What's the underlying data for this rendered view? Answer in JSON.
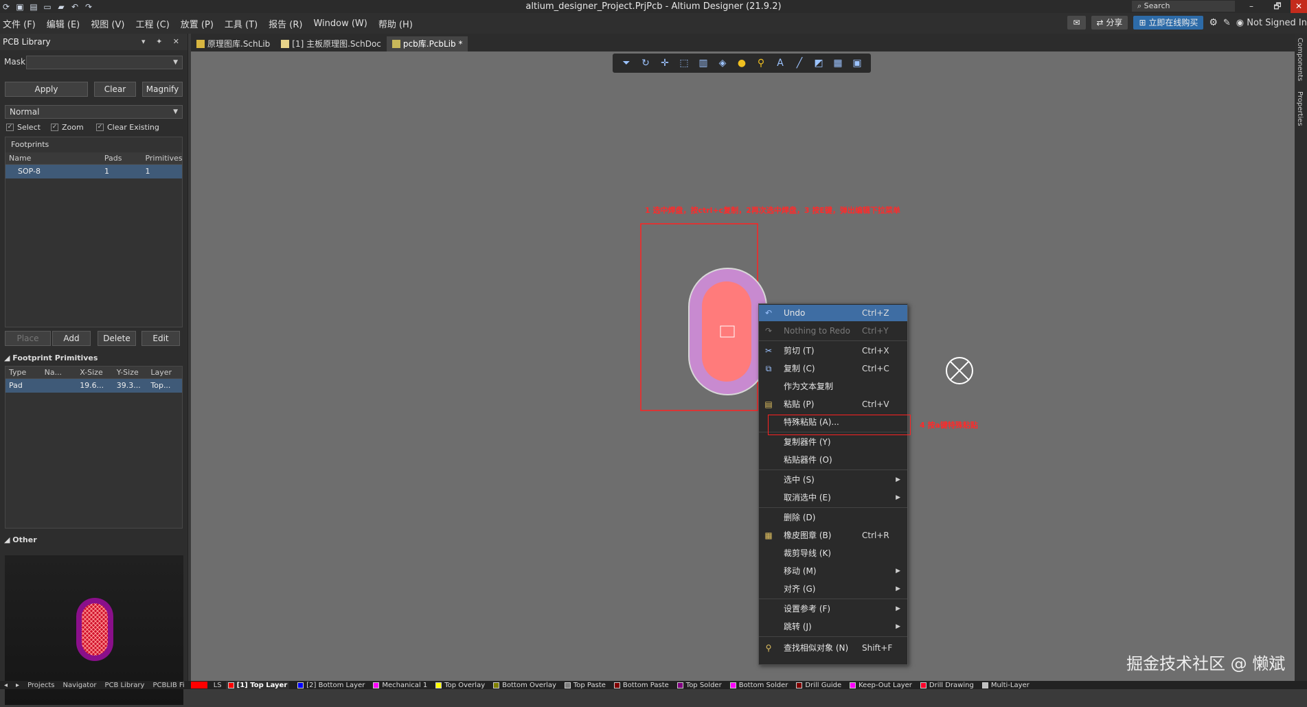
{
  "titlebar": {
    "title": "altium_designer_Project.PrjPcb - Altium Designer (21.9.2)",
    "search_placeholder": "Search",
    "minimize": "–",
    "maximize": "🗗",
    "close": "✕"
  },
  "menu": {
    "items": [
      "文件 (F)",
      "编辑 (E)",
      "视图 (V)",
      "工程 (C)",
      "放置 (P)",
      "工具 (T)",
      "报告 (R)",
      "Window (W)",
      "帮助 (H)"
    ],
    "share": "分享",
    "buy": "立即在线购买",
    "user": "Not Signed In"
  },
  "panel": {
    "title": "PCB Library",
    "mask_label": "Mask",
    "mask_value": "",
    "apply": "Apply",
    "clear": "Clear",
    "magnify": "Magnify",
    "mode": "Normal",
    "chk_select": "Select",
    "chk_zoom": "Zoom",
    "chk_clear_existing": "Clear Existing",
    "footprints_title": "Footprints",
    "footprint_headers": [
      "Name",
      "Pads",
      "Primitives"
    ],
    "footprint_rows": [
      [
        "SOP-8",
        "1",
        "1"
      ]
    ],
    "place": "Place",
    "add": "Add",
    "delete": "Delete",
    "edit": "Edit",
    "primitives_title": "Footprint Primitives",
    "primitive_headers": [
      "Type",
      "Na...",
      "X-Size",
      "Y-Size",
      "Layer"
    ],
    "primitive_rows": [
      [
        "Pad",
        "",
        "19.6...",
        "39.3...",
        "Top..."
      ]
    ],
    "other_title": "Other"
  },
  "tabs": [
    {
      "label": "原理图库.SchLib"
    },
    {
      "label": "[1] 主板原理图.SchDoc"
    },
    {
      "label": "pcb库.PcbLib *"
    }
  ],
  "rightbar": {
    "components": "Components",
    "properties": "Properties"
  },
  "annotations": {
    "step1": "1 选中焊盘，按ctrl+c复制，2再次选中焊盘，3 按E键，弹出编辑下拉菜单",
    "step4": "4 按a键特殊粘贴"
  },
  "context_menu": [
    {
      "label": "Undo",
      "shortcut": "Ctrl+Z",
      "icon": "undo-icon",
      "state": "highlight"
    },
    {
      "label": "Nothing to Redo",
      "shortcut": "Ctrl+Y",
      "icon": "redo-icon",
      "state": "disabled"
    },
    {
      "label": "剪切 (T)",
      "shortcut": "Ctrl+X",
      "icon": "cut-icon"
    },
    {
      "label": "复制 (C)",
      "shortcut": "Ctrl+C",
      "icon": "copy-icon"
    },
    {
      "label": "作为文本复制",
      "shortcut": ""
    },
    {
      "label": "粘贴 (P)",
      "shortcut": "Ctrl+V",
      "icon": "paste-icon"
    },
    {
      "label": "特殊粘贴 (A)...",
      "shortcut": ""
    },
    {
      "label": "复制器件 (Y)",
      "shortcut": ""
    },
    {
      "label": "粘贴器件 (O)",
      "shortcut": ""
    },
    {
      "label": "选中 (S)",
      "shortcut": "",
      "submenu": "▶"
    },
    {
      "label": "取消选中 (E)",
      "shortcut": "",
      "submenu": "▶"
    },
    {
      "label": "删除 (D)",
      "shortcut": ""
    },
    {
      "label": "橡皮图章 (B)",
      "shortcut": "Ctrl+R",
      "icon": "rubber-stamp-icon"
    },
    {
      "label": "裁剪导线 (K)",
      "shortcut": ""
    },
    {
      "label": "移动 (M)",
      "shortcut": "",
      "submenu": "▶"
    },
    {
      "label": "对齐 (G)",
      "shortcut": "",
      "submenu": "▶"
    },
    {
      "label": "设置参考 (F)",
      "shortcut": "",
      "submenu": "▶"
    },
    {
      "label": "跳转 (J)",
      "shortcut": "",
      "submenu": "▶"
    },
    {
      "label": "查找相似对象 (N)",
      "shortcut": "Shift+F",
      "icon": "find-similar-icon"
    }
  ],
  "status": {
    "left_tabs": [
      "Projects",
      "Navigator",
      "PCB Library",
      "PCBLIB Fi"
    ],
    "ls": "LS",
    "layers": [
      {
        "name": "[1] Top Layer",
        "color": "#ff0000",
        "active": true
      },
      {
        "name": "[2] Bottom Layer",
        "color": "#0000ff"
      },
      {
        "name": "Mechanical 1",
        "color": "#ff00ff"
      },
      {
        "name": "Top Overlay",
        "color": "#ffff00"
      },
      {
        "name": "Bottom Overlay",
        "color": "#808000"
      },
      {
        "name": "Top Paste",
        "color": "#808080"
      },
      {
        "name": "Bottom Paste",
        "color": "#800000"
      },
      {
        "name": "Top Solder",
        "color": "#800080"
      },
      {
        "name": "Bottom Solder",
        "color": "#ff00ff"
      },
      {
        "name": "Drill Guide",
        "color": "#800000"
      },
      {
        "name": "Keep-Out Layer",
        "color": "#ff00ff"
      },
      {
        "name": "Drill Drawing",
        "color": "#ff002a"
      },
      {
        "name": "Multi-Layer",
        "color": "#c0c0c0"
      }
    ]
  },
  "watermark": "掘金技术社区 @ 懒斌",
  "colors": {
    "pad_outer": "#c88ad0",
    "pad_inner": "#ff7b7b",
    "selection_red": "#ff2222",
    "menu_highlight": "#3e6da3"
  }
}
